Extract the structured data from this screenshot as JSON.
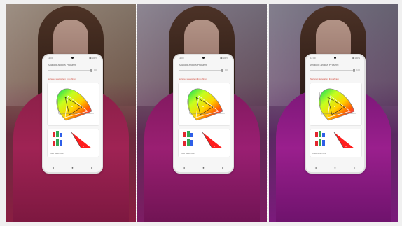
{
  "phone": {
    "status_left": "12:00",
    "status_right": "▮▮ 100%",
    "title": "Analogi ångpa Prosent",
    "slider_value": "100",
    "warning": "Sorteret sketetalem ling aftram",
    "analysis_caption": "Ralle   Sadle   Beth",
    "nav_labels": [
      "◂",
      "●",
      "▸"
    ]
  },
  "colors": {
    "warning": "#d14c3f",
    "phone_bg": "#f6f6f6",
    "triangle_red": "#ff1d1d",
    "bar_red": "#e3262f",
    "bar_green": "#37a851",
    "bar_blue": "#2f5fe8"
  },
  "icons": {
    "camera": "camera-hole-icon",
    "nav_back": "back-nav-icon",
    "nav_home": "home-nav-icon",
    "nav_recent": "recent-nav-icon"
  }
}
